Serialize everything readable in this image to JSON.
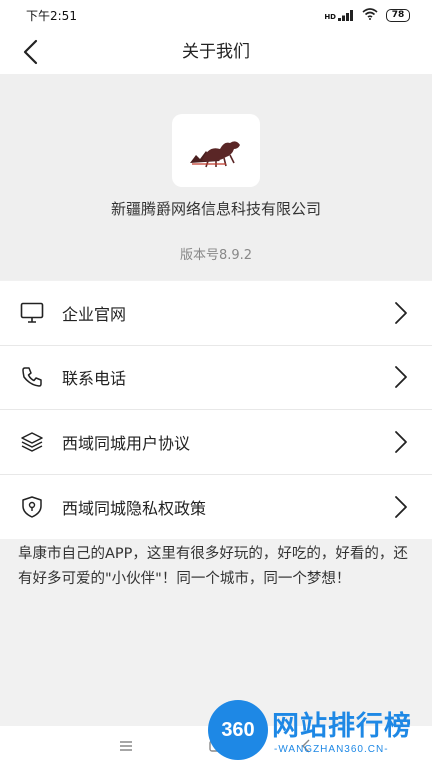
{
  "status_bar": {
    "time": "下午2:51",
    "signal_text": "HD",
    "battery": "78"
  },
  "nav": {
    "title": "关于我们"
  },
  "header": {
    "company_name": "新疆腾爵网络信息科技有限公司",
    "version": "版本号8.9.2"
  },
  "menu": {
    "items": [
      {
        "label": "企业官网",
        "icon": "monitor-icon"
      },
      {
        "label": "联系电话",
        "icon": "phone-icon"
      },
      {
        "label": "西域同城用户协议",
        "icon": "layers-icon"
      },
      {
        "label": "西域同城隐私权政策",
        "icon": "shield-icon"
      }
    ]
  },
  "description": "阜康市自己的APP，这里有很多好玩的，好吃的，好看的，还有好多可爱的\"小伙伴\"！同一个城市，同一个梦想！",
  "watermark": {
    "badge": "360",
    "title": "网站排行榜",
    "subtitle": "-WANGZHAN360.CN-"
  },
  "colors": {
    "accent": "#1e88e5",
    "background": "#f1f1f1"
  }
}
